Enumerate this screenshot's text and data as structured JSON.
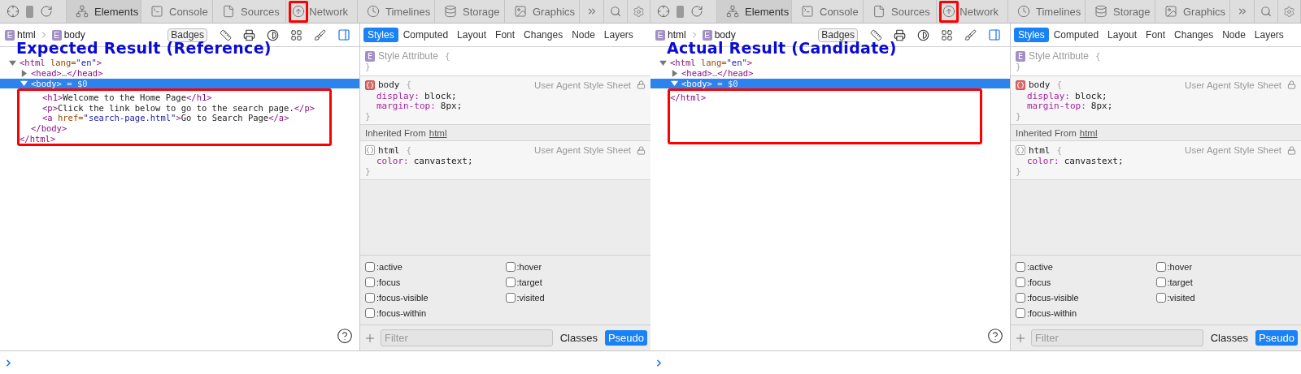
{
  "panes": [
    {
      "caption": "Expected Result (Reference)",
      "toolbar": {
        "tabs": [
          {
            "label": "Elements",
            "selected": true,
            "annotated": false
          },
          {
            "label": "Console",
            "selected": false,
            "annotated": false
          },
          {
            "label": "Sources",
            "selected": false,
            "annotated": false
          },
          {
            "label": "Network",
            "selected": false,
            "annotated": true
          },
          {
            "label": "Timelines",
            "selected": false,
            "annotated": false
          },
          {
            "label": "Storage",
            "selected": false,
            "annotated": false
          },
          {
            "label": "Graphics",
            "selected": false,
            "annotated": false
          }
        ]
      },
      "breadcrumbs": [
        {
          "badge": "E",
          "label": "html"
        },
        {
          "badge": "E",
          "label": "body"
        }
      ],
      "badges_button": "Badges",
      "dom": {
        "annotation_box": true,
        "nodes": [
          {
            "segments": [
              {
                "kind": "tag",
                "text": "<html"
              },
              {
                "kind": "attr",
                "text": " lang="
              },
              {
                "kind": "value",
                "text": "\"en\""
              },
              {
                "kind": "tag",
                "text": ">"
              }
            ],
            "expanded": true,
            "selected": false,
            "closing": "</html>",
            "children": [
              {
                "segments": [
                  {
                    "kind": "tag",
                    "text": "<head>"
                  },
                  {
                    "kind": "dim",
                    "text": "…"
                  },
                  {
                    "kind": "tag",
                    "text": "</head>"
                  }
                ],
                "expanded": false,
                "selected": false
              },
              {
                "segments": [
                  {
                    "kind": "tag",
                    "text": "<body>"
                  },
                  {
                    "kind": "plain",
                    "text": " = $0"
                  }
                ],
                "expanded": true,
                "selected": true,
                "closing": "</body>",
                "children": [
                  {
                    "segments": [
                      {
                        "kind": "tag",
                        "text": "<h1>"
                      },
                      {
                        "kind": "plain",
                        "text": "Welcome to the Home Page"
                      },
                      {
                        "kind": "tag",
                        "text": "</h1>"
                      }
                    ],
                    "selected": false
                  },
                  {
                    "segments": [
                      {
                        "kind": "tag",
                        "text": "<p>"
                      },
                      {
                        "kind": "plain",
                        "text": "Click the link below to go to the search page."
                      },
                      {
                        "kind": "tag",
                        "text": "</p>"
                      }
                    ],
                    "selected": false
                  },
                  {
                    "segments": [
                      {
                        "kind": "tag",
                        "text": "<a"
                      },
                      {
                        "kind": "attr",
                        "text": " href="
                      },
                      {
                        "kind": "value",
                        "text": "\"search-page.html\""
                      },
                      {
                        "kind": "tag",
                        "text": ">"
                      },
                      {
                        "kind": "plain",
                        "text": "Go to Search Page"
                      },
                      {
                        "kind": "tag",
                        "text": "</a>"
                      }
                    ],
                    "selected": false
                  }
                ]
              }
            ]
          }
        ]
      },
      "sidebar": {
        "tabs": [
          {
            "label": "Styles",
            "selected": true
          },
          {
            "label": "Computed",
            "selected": false
          },
          {
            "label": "Layout",
            "selected": false
          },
          {
            "label": "Font",
            "selected": false
          },
          {
            "label": "Changes",
            "selected": false
          },
          {
            "label": "Node",
            "selected": false
          },
          {
            "label": "Layers",
            "selected": false
          }
        ],
        "sections": [
          {
            "kind": "attribute",
            "badge": "E",
            "selector": "Style Attribute",
            "open": "{",
            "close": "}"
          },
          {
            "kind": "rule",
            "inherited": false,
            "selector": "body",
            "open": "{",
            "source": "User Agent Style Sheet",
            "properties": [
              {
                "name": "display:",
                "value": "block;"
              },
              {
                "name": "margin-top:",
                "value": "8px;"
              }
            ],
            "close": "}"
          },
          {
            "kind": "inherited",
            "text": "Inherited From",
            "link": "html"
          },
          {
            "kind": "rule",
            "inherited": true,
            "selector": "html",
            "open": "{",
            "source": "User Agent Style Sheet",
            "properties": [
              {
                "name": "color:",
                "value": "canvastext;"
              }
            ],
            "close": "}"
          }
        ],
        "pseudo": [
          {
            "label": ":active",
            "checked": false
          },
          {
            "label": ":hover",
            "checked": false
          },
          {
            "label": ":focus",
            "checked": false
          },
          {
            "label": ":target",
            "checked": false
          },
          {
            "label": ":focus-visible",
            "checked": false
          },
          {
            "label": ":visited",
            "checked": false
          },
          {
            "label": ":focus-within",
            "checked": false
          }
        ],
        "filter": {
          "placeholder": "Filter"
        },
        "buttons": [
          {
            "label": "Classes",
            "selected": false
          },
          {
            "label": "Pseudo",
            "selected": true
          }
        ]
      }
    },
    {
      "caption": "Actual Result (Candidate)",
      "toolbar": {
        "tabs": [
          {
            "label": "Elements",
            "selected": true,
            "annotated": false
          },
          {
            "label": "Console",
            "selected": false,
            "annotated": false
          },
          {
            "label": "Sources",
            "selected": false,
            "annotated": false
          },
          {
            "label": "Network",
            "selected": false,
            "annotated": true
          },
          {
            "label": "Timelines",
            "selected": false,
            "annotated": false
          },
          {
            "label": "Storage",
            "selected": false,
            "annotated": false
          },
          {
            "label": "Graphics",
            "selected": false,
            "annotated": false
          }
        ]
      },
      "breadcrumbs": [
        {
          "badge": "E",
          "label": "html"
        },
        {
          "badge": "E",
          "label": "body"
        }
      ],
      "badges_button": "Badges",
      "dom": {
        "annotation_box": true,
        "nodes": [
          {
            "segments": [
              {
                "kind": "tag",
                "text": "<html"
              },
              {
                "kind": "attr",
                "text": " lang="
              },
              {
                "kind": "value",
                "text": "\"en\""
              },
              {
                "kind": "tag",
                "text": ">"
              }
            ],
            "expanded": true,
            "selected": false,
            "closing": "</html>",
            "children": [
              {
                "segments": [
                  {
                    "kind": "tag",
                    "text": "<head>"
                  },
                  {
                    "kind": "dim",
                    "text": "…"
                  },
                  {
                    "kind": "tag",
                    "text": "</head>"
                  }
                ],
                "expanded": false,
                "selected": false
              },
              {
                "segments": [
                  {
                    "kind": "tag",
                    "text": "<body>"
                  },
                  {
                    "kind": "plain",
                    "text": " = $0"
                  }
                ],
                "expanded": true,
                "selected": true
              }
            ]
          }
        ]
      },
      "sidebar": {
        "tabs": [
          {
            "label": "Styles",
            "selected": true
          },
          {
            "label": "Computed",
            "selected": false
          },
          {
            "label": "Layout",
            "selected": false
          },
          {
            "label": "Font",
            "selected": false
          },
          {
            "label": "Changes",
            "selected": false
          },
          {
            "label": "Node",
            "selected": false
          },
          {
            "label": "Layers",
            "selected": false
          }
        ],
        "sections": [
          {
            "kind": "attribute",
            "badge": "E",
            "selector": "Style Attribute",
            "open": "{",
            "close": "}"
          },
          {
            "kind": "rule",
            "inherited": false,
            "selector": "body",
            "open": "{",
            "source": "User Agent Style Sheet",
            "properties": [
              {
                "name": "display:",
                "value": "block;"
              },
              {
                "name": "margin-top:",
                "value": "8px;"
              }
            ],
            "close": "}"
          },
          {
            "kind": "inherited",
            "text": "Inherited From",
            "link": "html"
          },
          {
            "kind": "rule",
            "inherited": true,
            "selector": "html",
            "open": "{",
            "source": "User Agent Style Sheet",
            "properties": [
              {
                "name": "color:",
                "value": "canvastext;"
              }
            ],
            "close": "}"
          }
        ],
        "pseudo": [
          {
            "label": ":active",
            "checked": false
          },
          {
            "label": ":hover",
            "checked": false
          },
          {
            "label": ":focus",
            "checked": false
          },
          {
            "label": ":target",
            "checked": false
          },
          {
            "label": ":focus-visible",
            "checked": false
          },
          {
            "label": ":visited",
            "checked": false
          },
          {
            "label": ":focus-within",
            "checked": false
          }
        ],
        "filter": {
          "placeholder": "Filter"
        },
        "buttons": [
          {
            "label": "Classes",
            "selected": false
          },
          {
            "label": "Pseudo",
            "selected": true
          }
        ]
      }
    }
  ]
}
